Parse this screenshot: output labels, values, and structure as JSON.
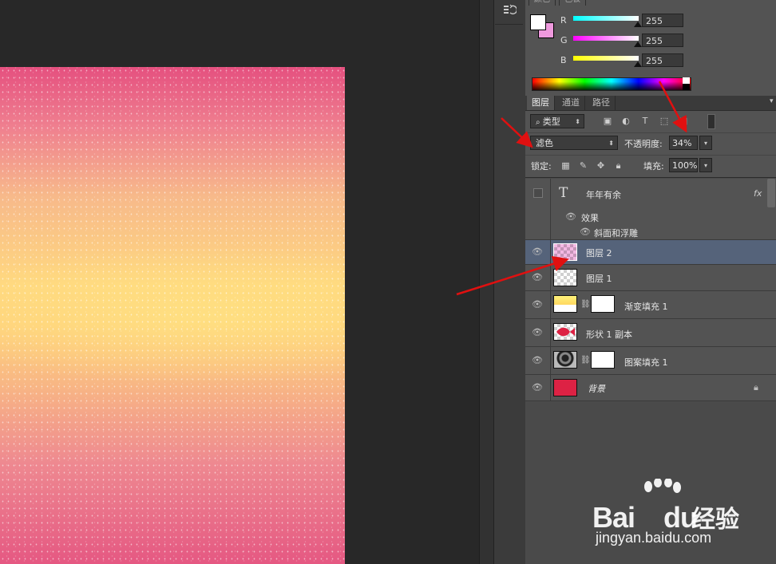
{
  "color_panel": {
    "tabs": [
      "颜色",
      "色板"
    ],
    "channels": [
      {
        "label": "R",
        "value": "255",
        "start": "#00ffff",
        "end": "#ffffff"
      },
      {
        "label": "G",
        "value": "255",
        "start": "#ff00ff",
        "end": "#ffffff"
      },
      {
        "label": "B",
        "value": "255",
        "start": "#ffff00",
        "end": "#ffffff"
      }
    ],
    "foreground_color": "#ffffff",
    "background_color": "#ee99dd"
  },
  "layers_panel": {
    "tabs": [
      "图层",
      "通道",
      "路径"
    ],
    "filter_select": "类型",
    "blend_mode": "滤色",
    "opacity_label": "不透明度:",
    "opacity_value": "34%",
    "lock_label": "锁定:",
    "fill_label": "填充:",
    "fill_value": "100%",
    "layers": [
      {
        "name": "年年有余",
        "kind": "text",
        "visible": false,
        "fx": "fx"
      },
      {
        "name": "效果",
        "kind": "effects-header"
      },
      {
        "name": "斜面和浮雕",
        "kind": "effect"
      },
      {
        "name": "图层 2",
        "kind": "pixel",
        "selected": true
      },
      {
        "name": "图层 1",
        "kind": "pixel"
      },
      {
        "name": "渐变填充 1",
        "kind": "gradient-fill"
      },
      {
        "name": "形状 1 副本",
        "kind": "shape"
      },
      {
        "name": "图案填充 1",
        "kind": "pattern-fill"
      },
      {
        "name": "背景",
        "kind": "background",
        "locked": true
      }
    ]
  },
  "watermark": {
    "brand": "Bai",
    "brand_suffix": "du",
    "brand_cn": "经验",
    "url": "jingyan.baidu.com"
  },
  "colors": {
    "panel_bg": "#535353",
    "selected_row": "#55637a",
    "background_layer": "#dd2244",
    "annotation_arrow": "#e01010"
  }
}
